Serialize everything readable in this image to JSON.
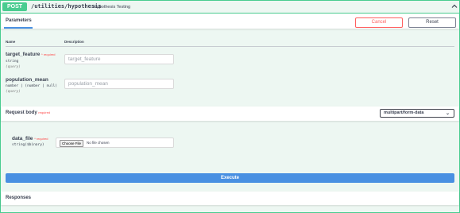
{
  "operation": {
    "method": "POST",
    "path": "/utilities/hypothesis",
    "summary": "Hypothesis Testing",
    "collapse_icon": "chevron-up-icon"
  },
  "parameters": {
    "title": "Parameters",
    "cancel_label": "Cancel",
    "reset_label": "Reset",
    "col_name": "Name",
    "col_description": "Description",
    "items": [
      {
        "name": "target_feature",
        "required": "* required",
        "type": "string",
        "in": "(query)",
        "placeholder": "target_feature",
        "value": ""
      },
      {
        "name": "population_mean",
        "required": "",
        "type": "number | (number | null)",
        "in": "(query)",
        "placeholder": "population_mean",
        "value": ""
      }
    ]
  },
  "request_body": {
    "title": "Request body",
    "required": "required",
    "content_type": "multipart/form-data",
    "field": {
      "name": "data_file",
      "required": "* required",
      "type": "string($binary)",
      "choose_label": "Choose File",
      "file_status": "No file chosen"
    }
  },
  "execute_label": "Execute",
  "responses_title": "Responses",
  "colors": {
    "post": "#49cc90",
    "post_bg": "#edf7f2",
    "execute": "#4990e2",
    "cancel": "#ff6060"
  }
}
